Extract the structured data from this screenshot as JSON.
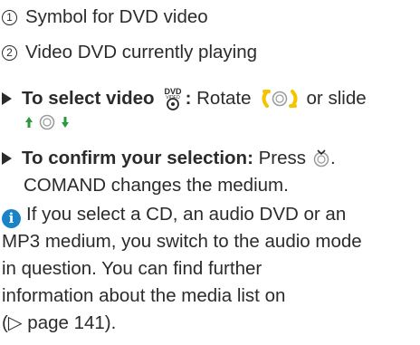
{
  "legend": [
    {
      "number": "1",
      "text": "Symbol for DVD video"
    },
    {
      "number": "2",
      "text": "Video DVD currently playing"
    }
  ],
  "instructions": [
    {
      "bold": "To select video",
      "after_icon": ":",
      "text": " Rotate",
      "or_text": "or slide"
    },
    {
      "bold": "To confirm your selection:",
      "text": " Press",
      "line2": "COMAND changes the medium."
    }
  ],
  "note": {
    "lines": [
      "If you select a CD, an audio DVD or an",
      "MP3 medium, you switch to the audio mode",
      "in question. You can find further",
      "information about the media list on",
      "(▷ page 141)."
    ]
  },
  "icons": {
    "dvd_video": "dvd-video-icon",
    "rotate": "rotate-controller-icon",
    "slide": "slide-controller-icon",
    "press": "press-controller-icon",
    "info": "info-icon"
  },
  "colors": {
    "text": "#2b2b2b",
    "accent_yellow": "#f5c400",
    "accent_green": "#2a9a3c",
    "info_blue": "#1a83c8"
  }
}
